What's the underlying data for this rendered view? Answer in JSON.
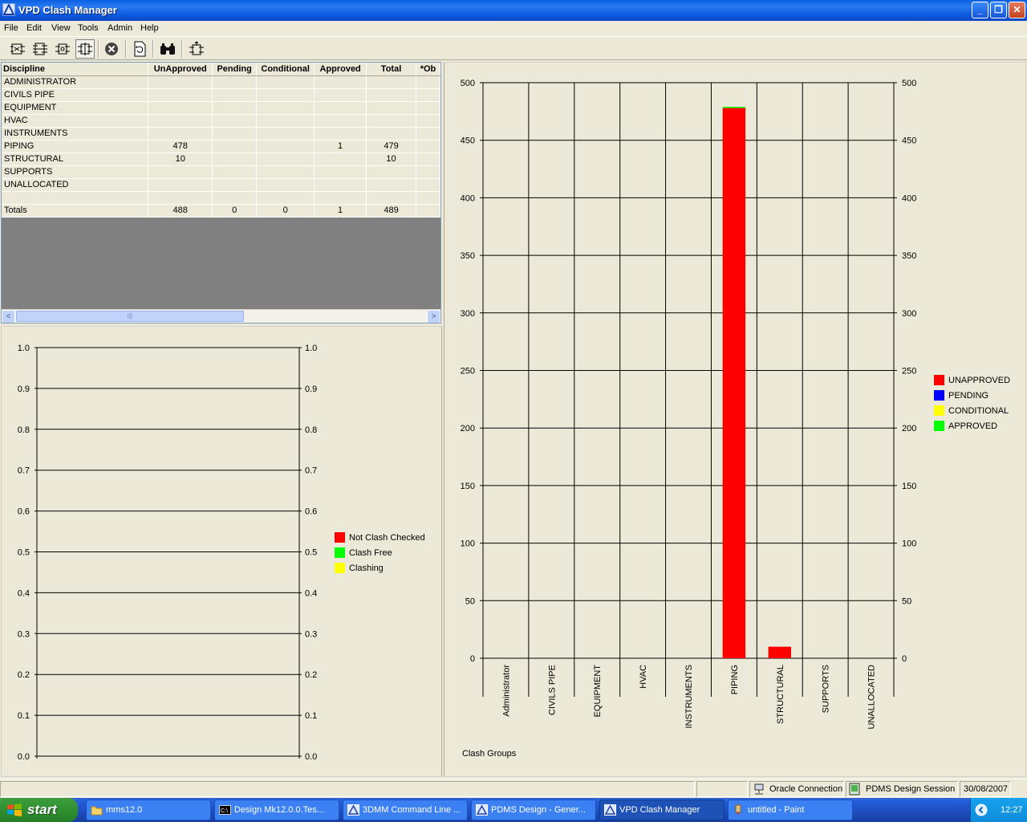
{
  "window": {
    "title": "VPD Clash Manager"
  },
  "menu": [
    "File",
    "Edit",
    "View",
    "Tools",
    "Admin",
    "Help"
  ],
  "toolbar": {
    "buttons": [
      "clash-check-icon",
      "batch-clash-icon",
      "refresh-clash-icon",
      "filter-clash-icon",
      "stop-icon",
      "update-icon",
      "find-icon",
      "export-icon"
    ]
  },
  "grid": {
    "columns": [
      "Discipline",
      "UnApproved",
      "Pending",
      "Conditional",
      "Approved",
      "Total",
      "*Ob"
    ],
    "rows": [
      [
        "ADMINISTRATOR",
        "",
        "",
        "",
        "",
        "",
        ""
      ],
      [
        "CIVILS PIPE",
        "",
        "",
        "",
        "",
        "",
        ""
      ],
      [
        "EQUIPMENT",
        "",
        "",
        "",
        "",
        "",
        ""
      ],
      [
        "HVAC",
        "",
        "",
        "",
        "",
        "",
        ""
      ],
      [
        "INSTRUMENTS",
        "",
        "",
        "",
        "",
        "",
        ""
      ],
      [
        "PIPING",
        "478",
        "",
        "",
        "1",
        "479",
        ""
      ],
      [
        "STRUCTURAL",
        "10",
        "",
        "",
        "",
        "10",
        ""
      ],
      [
        "SUPPORTS",
        "",
        "",
        "",
        "",
        "",
        ""
      ],
      [
        "UNALLOCATED",
        "",
        "",
        "",
        "",
        "",
        ""
      ],
      [
        "",
        "",
        "",
        "",
        "",
        "",
        ""
      ],
      [
        "Totals",
        "488",
        "0",
        "0",
        "1",
        "489",
        ""
      ]
    ]
  },
  "chart_data": [
    {
      "type": "bar",
      "categories": [],
      "series": [
        {
          "name": "Not Clash Checked",
          "values": []
        },
        {
          "name": "Clash Free",
          "values": []
        },
        {
          "name": "Clashing",
          "values": []
        }
      ],
      "ylim": [
        0,
        1.0
      ],
      "yticks": [
        "0.0",
        "0.1",
        "0.2",
        "0.3",
        "0.4",
        "0.5",
        "0.6",
        "0.7",
        "0.8",
        "0.9",
        "1.0"
      ],
      "colors": [
        "#ff0000",
        "#00ff00",
        "#ffff00"
      ],
      "legend_position": "right",
      "grid": true
    },
    {
      "type": "bar",
      "stacked": true,
      "categories": [
        "Administrator",
        "CIVILS PIPE",
        "EQUIPMENT",
        "HVAC",
        "INSTRUMENTS",
        "PIPING",
        "STRUCTURAL",
        "SUPPORTS",
        "UNALLOCATED"
      ],
      "series": [
        {
          "name": "UNAPPROVED",
          "values": [
            0,
            0,
            0,
            0,
            0,
            478,
            10,
            0,
            0
          ]
        },
        {
          "name": "PENDING",
          "values": [
            0,
            0,
            0,
            0,
            0,
            0,
            0,
            0,
            0
          ]
        },
        {
          "name": "CONDITIONAL",
          "values": [
            0,
            0,
            0,
            0,
            0,
            0,
            0,
            0,
            0
          ]
        },
        {
          "name": "APPROVED",
          "values": [
            0,
            0,
            0,
            0,
            0,
            1,
            0,
            0,
            0
          ]
        }
      ],
      "colors": [
        "#ff0000",
        "#0000ff",
        "#ffff00",
        "#00ff00"
      ],
      "xlabel": "Clash Groups",
      "ylim": [
        0,
        500
      ],
      "yticks": [
        "0",
        "50",
        "100",
        "150",
        "200",
        "250",
        "300",
        "350",
        "400",
        "450",
        "500"
      ],
      "legend_position": "right",
      "grid": true
    }
  ],
  "status": {
    "connection": "Oracle Connection",
    "session": "PDMS Design Session",
    "date": "30/08/2007"
  },
  "taskbar": {
    "start": "start",
    "tasks": [
      "mms12.0",
      "Design Mk12.0.0.Tes...",
      "3DMM Command Line ...",
      "PDMS Design - Gener...",
      "VPD Clash Manager",
      "untitled - Paint"
    ],
    "clock": "12:27"
  }
}
